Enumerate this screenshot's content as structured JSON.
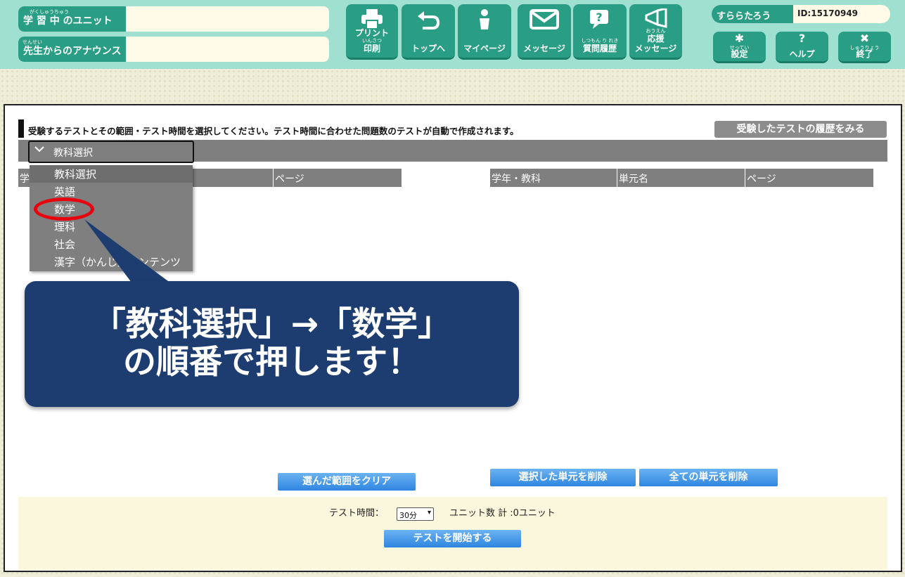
{
  "header": {
    "learning_unit_ruby": "がくしゅうちゅう",
    "learning_unit_label": "学 習 中 のユニット",
    "announce_ruby": "せんせい",
    "announce_label": "先生からのアナウンス",
    "nav": [
      {
        "icon": "printer-icon",
        "line1": "プリント",
        "ruby": "いんさつ",
        "line2": "印刷"
      },
      {
        "icon": "return-arrow-icon",
        "line1": "",
        "ruby": "",
        "line2": "トップへ"
      },
      {
        "icon": "person-icon",
        "line1": "",
        "ruby": "",
        "line2": "マイページ"
      },
      {
        "icon": "envelope-icon",
        "line1": "",
        "ruby": "",
        "line2": "メッセージ"
      },
      {
        "icon": "question-bubble-icon",
        "line1": "",
        "ruby": "しつもん り れき",
        "line2": "質問履歴"
      },
      {
        "icon": "megaphone-icon",
        "line1": "応援",
        "ruby": "おうえん",
        "line2": "メッセージ"
      }
    ],
    "user_name": "すららたろう",
    "user_id": "ID:15170949",
    "settings_ruby": "せってい",
    "settings_label": "設定",
    "help_label": "ヘルプ",
    "exit_ruby": "しゅうりょう",
    "exit_label": "終了"
  },
  "main": {
    "instruction": "受験するテストとその範囲・テスト時間を選択してください。テスト時間に合わせた問題数のテストが自動で作成されます。",
    "history_button": "受験したテストの履歴をみる",
    "subject_select": "教科選択",
    "left_table_headers": [
      "学",
      "",
      "ページ"
    ],
    "right_table_headers": [
      "学年・教科",
      "単元名",
      "ページ"
    ],
    "dropdown_options": [
      "教科選択",
      "英語",
      "数学",
      "理科",
      "社会",
      "漢字（かんじ）コンテンツ"
    ],
    "callout_line1": "「教科選択」→「数学」",
    "callout_line2": "の順番で押します！",
    "clear_button": "選んだ範囲をクリア",
    "delete_selected_button": "選択した単元を削除",
    "delete_all_button": "全ての単元を削除",
    "test_time_label": "テスト時間：",
    "test_time_value": "30分",
    "unit_count": "ユニット数 計 :0ユニット",
    "start_button": "テストを開始する"
  }
}
